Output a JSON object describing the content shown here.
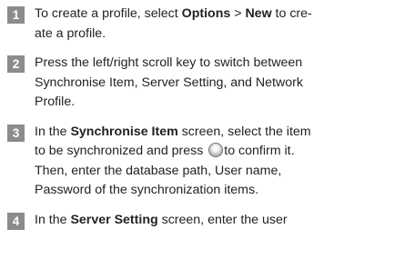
{
  "steps": [
    {
      "number": "1",
      "segments": [
        {
          "text": "To create a profile, select ",
          "bold": false
        },
        {
          "text": "Options",
          "bold": true
        },
        {
          "text": " > ",
          "bold": false
        },
        {
          "text": "New",
          "bold": true
        },
        {
          "text": " to cre-",
          "bold": false
        },
        {
          "br": true
        },
        {
          "text": "ate a profile.",
          "bold": false
        }
      ]
    },
    {
      "number": "2",
      "segments": [
        {
          "text": "Press the left/right scroll key to switch between",
          "bold": false
        },
        {
          "br": true
        },
        {
          "text": "Synchronise Item, Server Setting, and Network",
          "bold": false
        },
        {
          "br": true
        },
        {
          "text": "Profile.",
          "bold": false
        }
      ]
    },
    {
      "number": "3",
      "segments": [
        {
          "text": "In the ",
          "bold": false
        },
        {
          "text": "Synchronise Item",
          "bold": true
        },
        {
          "text": " screen, select the item",
          "bold": false
        },
        {
          "br": true
        },
        {
          "text": "to be synchronized and press ",
          "bold": false
        },
        {
          "icon": "confirm-key-icon"
        },
        {
          "text": "to confirm it.",
          "bold": false
        },
        {
          "br": true
        },
        {
          "text": "Then, enter the database path, User name,",
          "bold": false
        },
        {
          "br": true
        },
        {
          "text": "Password of the synchronization items.",
          "bold": false
        }
      ]
    },
    {
      "number": "4",
      "segments": [
        {
          "text": "In the ",
          "bold": false
        },
        {
          "text": "Server Setting",
          "bold": true
        },
        {
          "text": " screen, enter the user",
          "bold": false
        }
      ]
    }
  ]
}
